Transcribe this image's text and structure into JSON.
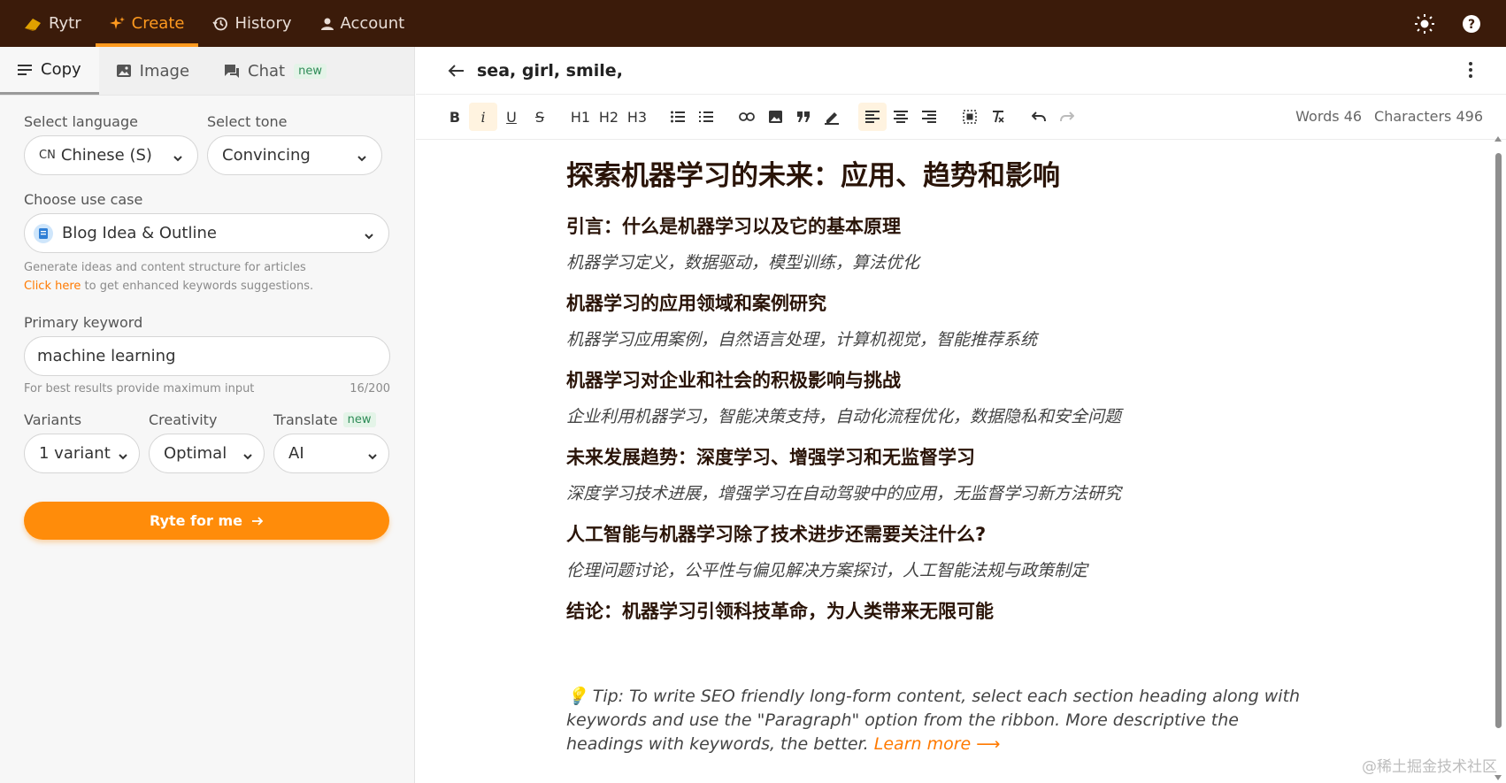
{
  "topbar": {
    "logo": "Rytr",
    "nav": [
      {
        "label": "Create"
      },
      {
        "label": "History"
      },
      {
        "label": "Account"
      }
    ]
  },
  "sidebar": {
    "tabs": [
      {
        "label": "Copy"
      },
      {
        "label": "Image"
      },
      {
        "label": "Chat",
        "badge": "new"
      }
    ],
    "language": {
      "label": "Select language",
      "value": "Chinese (S)",
      "flag": "CN"
    },
    "tone": {
      "label": "Select tone",
      "value": "Convincing"
    },
    "use_case": {
      "label": "Choose use case",
      "value": "Blog Idea & Outline",
      "description": "Generate ideas and content structure for articles",
      "link_text": "Click here",
      "link_suffix": " to get enhanced keywords suggestions."
    },
    "keyword": {
      "label": "Primary keyword",
      "value": "machine learning",
      "hint": "For best results provide maximum input",
      "count": "16/200"
    },
    "variants": {
      "label": "Variants",
      "value": "1 variant"
    },
    "creativity": {
      "label": "Creativity",
      "value": "Optimal"
    },
    "translate": {
      "label": "Translate",
      "badge": "new",
      "value": "AI"
    },
    "cta": "Ryte for me"
  },
  "editor": {
    "title": "sea, girl, smile,",
    "toolbar": {
      "bold": "B",
      "italic": "i",
      "underline": "U",
      "strike": "S",
      "h1": "H1",
      "h2": "H2",
      "h3": "H3"
    },
    "words": "Words 46",
    "characters": "Characters 496",
    "doc": {
      "h1": "探索机器学习的未来：应用、趋势和影响",
      "sections": [
        {
          "heading": "引言：什么是机器学习以及它的基本原理",
          "keywords": "机器学习定义，数据驱动，模型训练，算法优化"
        },
        {
          "heading": "机器学习的应用领域和案例研究",
          "keywords": "机器学习应用案例，自然语言处理，计算机视觉，智能推荐系统"
        },
        {
          "heading": "机器学习对企业和社会的积极影响与挑战",
          "keywords": "企业利用机器学习，智能决策支持，自动化流程优化，数据隐私和安全问题"
        },
        {
          "heading": "未来发展趋势：深度学习、增强学习和无监督学习",
          "keywords": "深度学习技术进展，增强学习在自动驾驶中的应用，无监督学习新方法研究"
        },
        {
          "heading": "人工智能与机器学习除了技术进步还需要关注什么?",
          "keywords": "伦理问题讨论，公平性与偏见解决方案探讨，人工智能法规与政策制定"
        },
        {
          "heading": "结论：机器学习引领科技革命，为人类带来无限可能",
          "keywords": ""
        }
      ]
    },
    "tip": "Tip: To write SEO friendly long-form content, select each section heading along with keywords and use the \"Paragraph\" option from the ribbon. More descriptive the headings with keywords, the better.",
    "tip_link": "Learn more ⟶"
  },
  "watermark": "@稀土掘金技术社区",
  "colors": {
    "accent": "#ff8c0a",
    "topbar": "#3b1b0a",
    "heading": "#2a1408"
  }
}
